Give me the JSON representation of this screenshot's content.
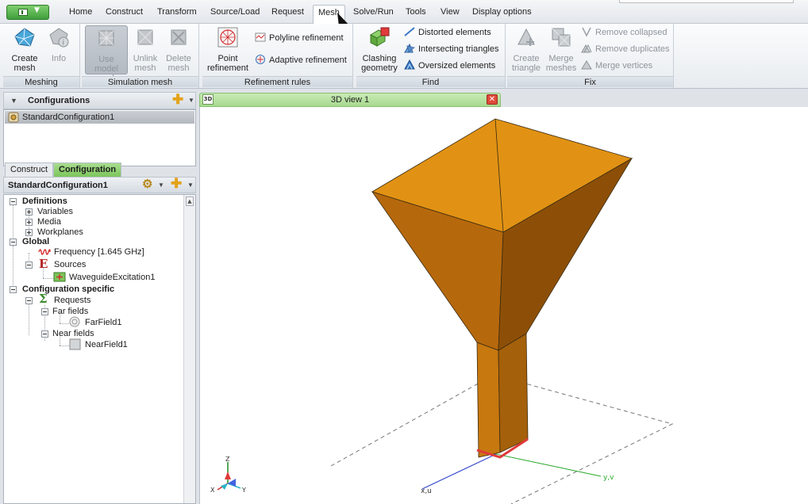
{
  "menu": {
    "items": [
      "Home",
      "Construct",
      "Transform",
      "Source/Load",
      "Request",
      "Mesh",
      "Solve/Run",
      "Tools",
      "View",
      "Display options"
    ],
    "active": "Mesh"
  },
  "ribbon": {
    "meshing": {
      "label": "Meshing",
      "create_mesh": "Create\nmesh",
      "info": "Info"
    },
    "simulation_mesh": {
      "label": "Simulation mesh",
      "use_model_mesh": "Use model\nmesh",
      "unlink_mesh": "Unlink\nmesh",
      "delete_mesh": "Delete\nmesh"
    },
    "refinement_rules": {
      "label": "Refinement rules",
      "point_refinement": "Point\nrefinement",
      "polyline_refinement": "Polyline refinement",
      "adaptive_refinement": "Adaptive refinement"
    },
    "find": {
      "label": "Find",
      "clashing_geometry": "Clashing\ngeometry",
      "distorted_elements": "Distorted elements",
      "intersecting_triangles": "Intersecting triangles",
      "oversized_elements": "Oversized elements"
    },
    "fix": {
      "label": "Fix",
      "create_triangle": "Create\ntriangle",
      "merge_meshes": "Merge\nmeshes",
      "remove_collapsed": "Remove collapsed",
      "remove_duplicates": "Remove duplicates",
      "merge_vertices": "Merge vertices"
    }
  },
  "configurations": {
    "title": "Configurations",
    "items": [
      "StandardConfiguration1"
    ]
  },
  "tabs": {
    "construct": "Construct",
    "configuration": "Configuration"
  },
  "tree": {
    "title": "StandardConfiguration1",
    "definitions": "Definitions",
    "variables": "Variables",
    "media": "Media",
    "workplanes": "Workplanes",
    "global": "Global",
    "frequency": "Frequency [1.645 GHz]",
    "sources": "Sources",
    "waveguide_excitation": "WaveguideExcitation1",
    "configuration_specific": "Configuration specific",
    "requests": "Requests",
    "far_fields": "Far fields",
    "farfield1": "FarField1",
    "near_fields": "Near fields",
    "nearfield1": "NearField1"
  },
  "view": {
    "tab_label": "3D view 1",
    "tab_icon_text": "3D",
    "axis_labels": {
      "x": "X",
      "y": "Y",
      "z": "Z",
      "uv_x": "x,u",
      "uv_y": "y,v"
    },
    "colors": {
      "horn": "#c7780f",
      "horn_top": "#e19214",
      "ground": "#555"
    }
  }
}
